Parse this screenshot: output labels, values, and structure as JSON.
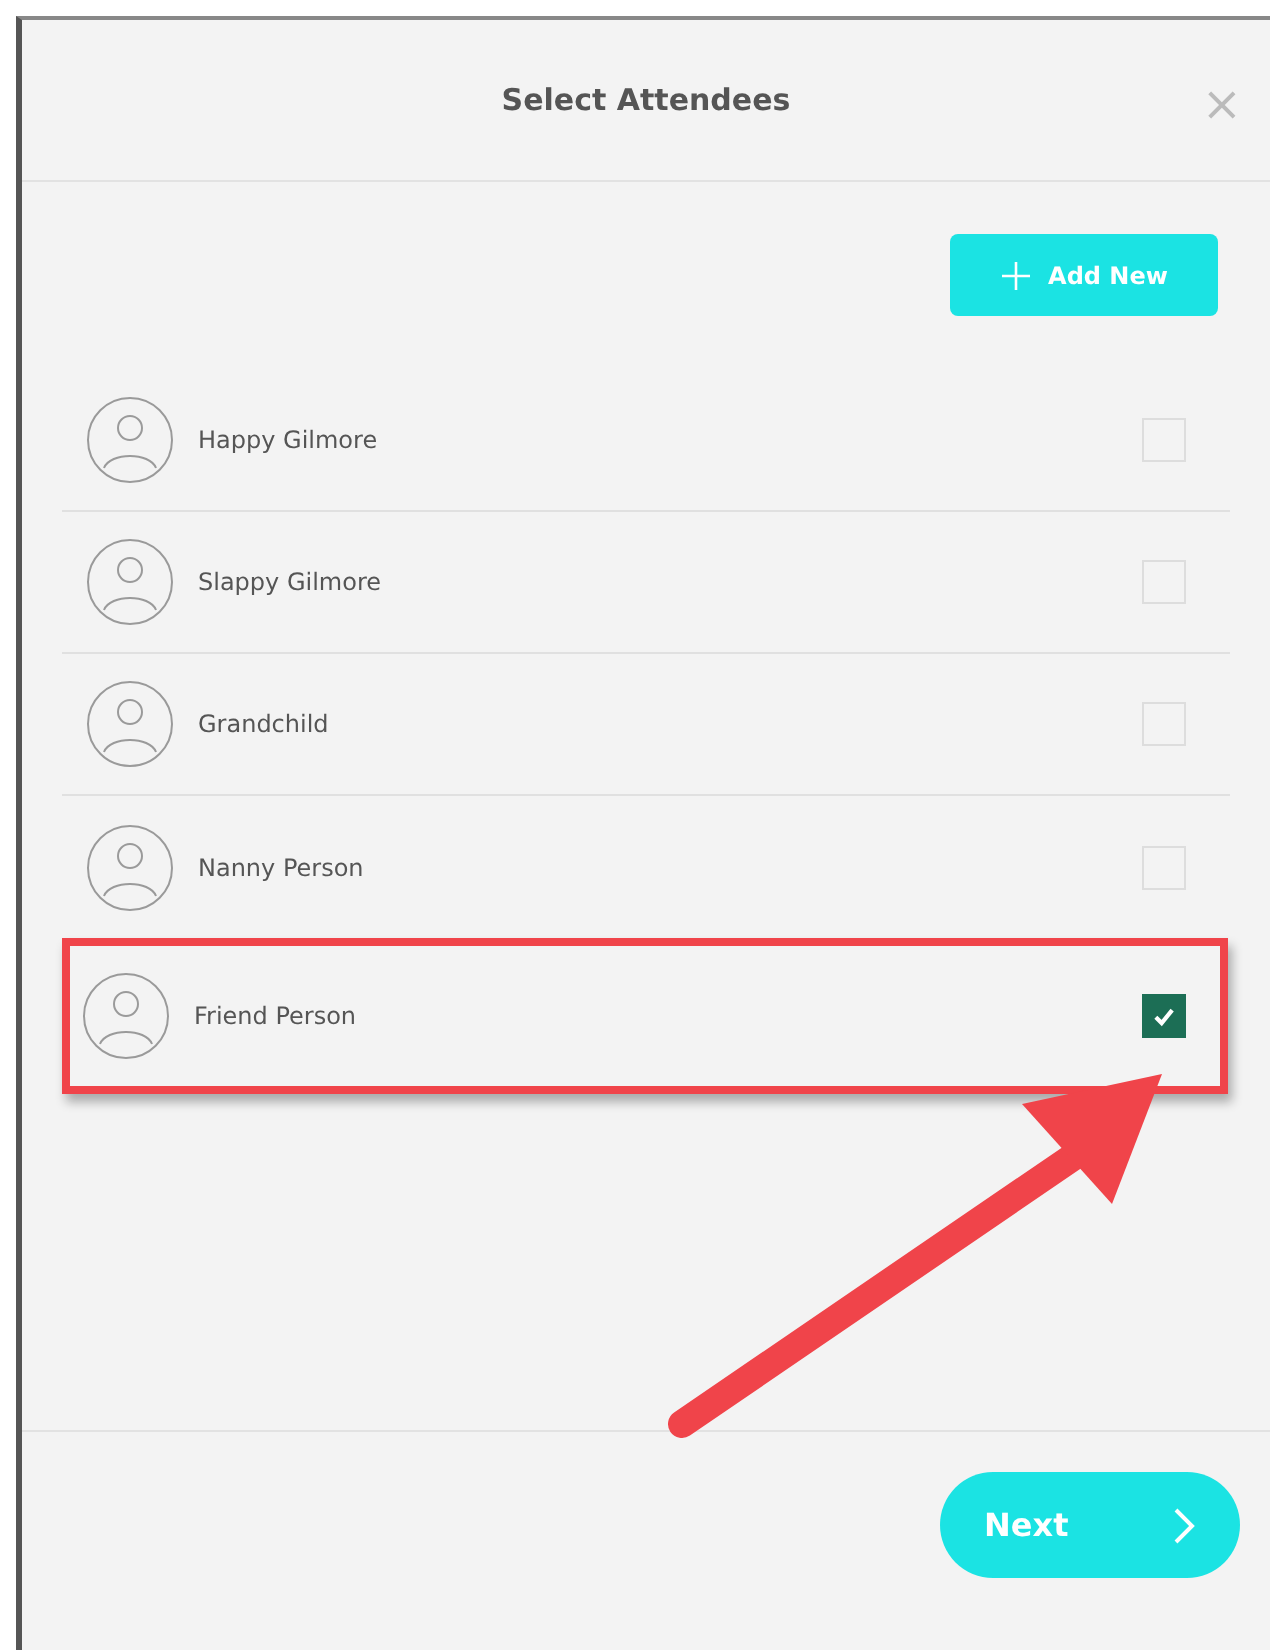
{
  "dialog": {
    "title": "Select Attendees",
    "close": "×",
    "add_button": "Add New"
  },
  "attendees": [
    {
      "name": "Happy Gilmore",
      "checked": false,
      "highlighted": false
    },
    {
      "name": "Slappy Gilmore",
      "checked": false,
      "highlighted": false
    },
    {
      "name": "Grandchild",
      "checked": false,
      "highlighted": false
    },
    {
      "name": "Nanny Person",
      "checked": false,
      "highlighted": false
    },
    {
      "name": "Friend Person",
      "checked": true,
      "highlighted": true
    }
  ],
  "footer": {
    "next_button": "Next"
  }
}
